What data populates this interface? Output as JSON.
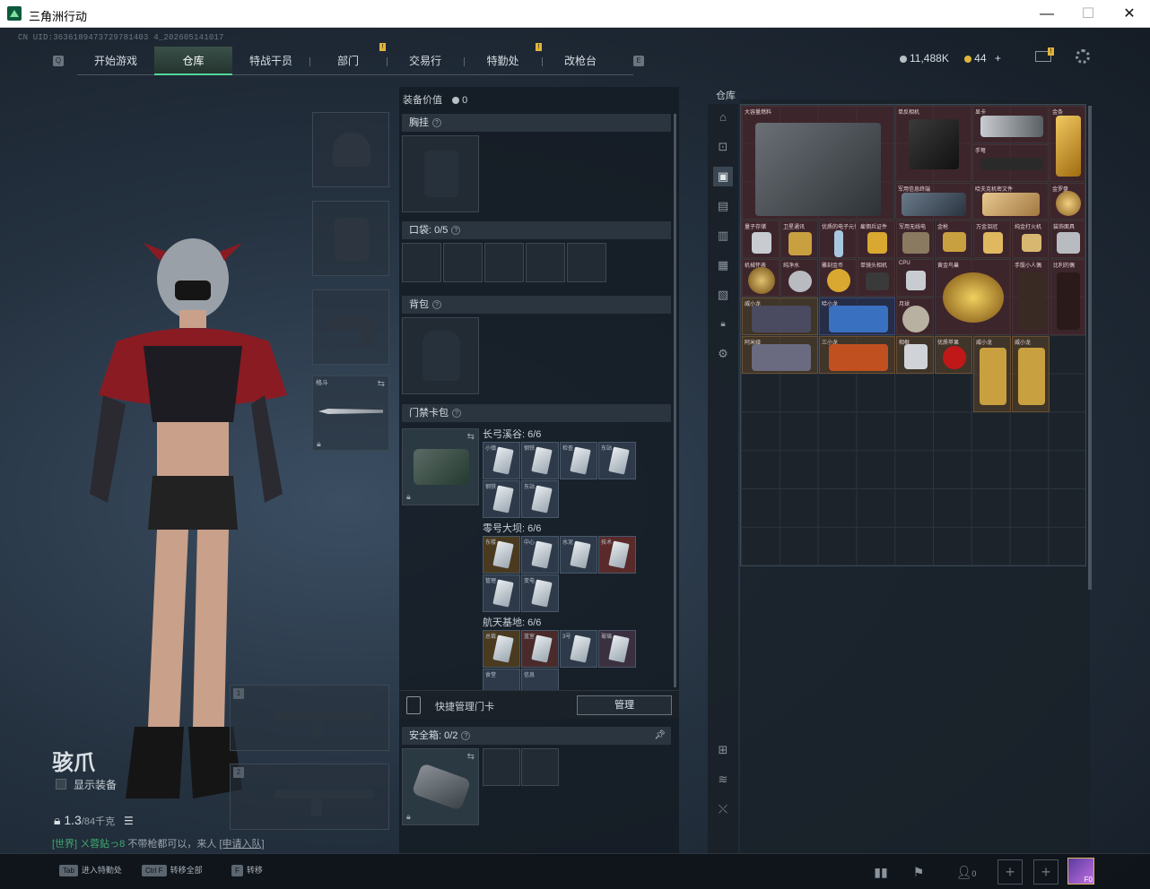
{
  "window": {
    "title": "三角洲行动",
    "minimize": "—",
    "maximize": "☐",
    "close": "✕"
  },
  "uid": "CN UID:3636189473729781403 4_202605141017",
  "nav": {
    "tabs": [
      {
        "label": "开始游戏",
        "active": false
      },
      {
        "label": "仓库",
        "active": true
      },
      {
        "label": "特战干员",
        "active": false
      },
      {
        "label": "部门",
        "active": false
      },
      {
        "label": "交易行",
        "active": false
      },
      {
        "label": "特勤处",
        "active": false
      },
      {
        "label": "改枪台",
        "active": false
      }
    ],
    "left_key": "Q",
    "right_key": "E"
  },
  "currency": {
    "coins": "11,488K",
    "tokens": "44",
    "plus": "+"
  },
  "character": {
    "name": "骇爪",
    "show_equipment_label": "显示装备",
    "weight": "1.3",
    "weight_max": "/84千克"
  },
  "chat": {
    "channel": "[世界]",
    "user": "ㄨ蓉鉆っ8",
    "message": "不带枪都可以，来人",
    "link": "[申请入队]"
  },
  "equipment": {
    "value_label": "装备价值",
    "value": "0",
    "chest_label": "胸挂",
    "pocket_label": "口袋:",
    "pocket_count": "0/5",
    "backpack_label": "背包",
    "keycard_label": "门禁卡包",
    "melee_label": "格斗",
    "maps": [
      {
        "name": "长弓溪谷:",
        "count": "6/6",
        "cards": [
          "小镇",
          "钢铁",
          "检查",
          "东站",
          "钢铁",
          "东站"
        ]
      },
      {
        "name": "零号大坝:",
        "count": "6/6",
        "cards": [
          "东楼",
          "中心",
          "水泥",
          "技术",
          "管理",
          "变电"
        ]
      },
      {
        "name": "航天基地:",
        "count": "6/6",
        "cards": [
          "总裁",
          "蓝室",
          "3号",
          "玻璃",
          "食堂",
          "信息"
        ]
      }
    ],
    "quick_manage_label": "快捷管理门卡",
    "manage_button": "管理",
    "safe_label": "安全箱:",
    "safe_count": "0/2",
    "weapon_slots": [
      "1",
      "2"
    ]
  },
  "stash": {
    "title": "仓库",
    "items": [
      {
        "name": "大容量燃料",
        "color": "red"
      },
      {
        "name": "单反相机",
        "color": "red"
      },
      {
        "name": "显卡",
        "color": "red"
      },
      {
        "name": "金条",
        "color": "red"
      },
      {
        "name": "手弩",
        "color": "red"
      },
      {
        "name": "军用信息终端",
        "color": "red"
      },
      {
        "name": "哈夫克机密文件",
        "color": "red"
      },
      {
        "name": "金罗盘",
        "color": "red"
      },
      {
        "name": "量子存储",
        "color": "red"
      },
      {
        "name": "卫星通讯",
        "color": "red"
      },
      {
        "name": "优质的电子元件",
        "color": "red"
      },
      {
        "name": "雇佣兵证件",
        "color": "red"
      },
      {
        "name": "军用无线电",
        "color": "red"
      },
      {
        "name": "金枪",
        "color": "red"
      },
      {
        "name": "万金泪冠",
        "color": "red"
      },
      {
        "name": "纯金打火机",
        "color": "red"
      },
      {
        "name": "装饰面具",
        "color": "red"
      },
      {
        "name": "机械怀表",
        "color": "red"
      },
      {
        "name": "纯净水",
        "color": "red"
      },
      {
        "name": "雕刻金币",
        "color": "red"
      },
      {
        "name": "单镜头相机",
        "color": "red"
      },
      {
        "name": "CPU",
        "color": "red"
      },
      {
        "name": "黄金鸟巢",
        "color": "red"
      },
      {
        "name": "手骰小人偶",
        "color": "red"
      },
      {
        "name": "比利的偶",
        "color": "red"
      },
      {
        "name": "威小龙",
        "color": "brown"
      },
      {
        "name": "哈小龙",
        "color": "blue"
      },
      {
        "name": "月球",
        "color": "red"
      },
      {
        "name": "阿米娅",
        "color": "brown"
      },
      {
        "name": "三小龙",
        "color": "brown"
      },
      {
        "name": "相框",
        "color": "brown"
      },
      {
        "name": "优质苹果",
        "color": "brown"
      },
      {
        "name": "威小龙",
        "color": "brown"
      },
      {
        "name": "威小龙",
        "color": "brown"
      }
    ]
  },
  "bottom": {
    "hotkeys": [
      {
        "key": "Tab",
        "label": "进入特勤处"
      },
      {
        "key": "Ctrl F",
        "label": "转移全部"
      },
      {
        "key": "F",
        "label": "转移"
      }
    ],
    "friends_count": "0",
    "level_badge": "F0"
  },
  "colors": {
    "accent": "#55d69a",
    "gold": "#e0b43a",
    "item_red": "#5a282d",
    "item_blue": "#2d375f"
  }
}
